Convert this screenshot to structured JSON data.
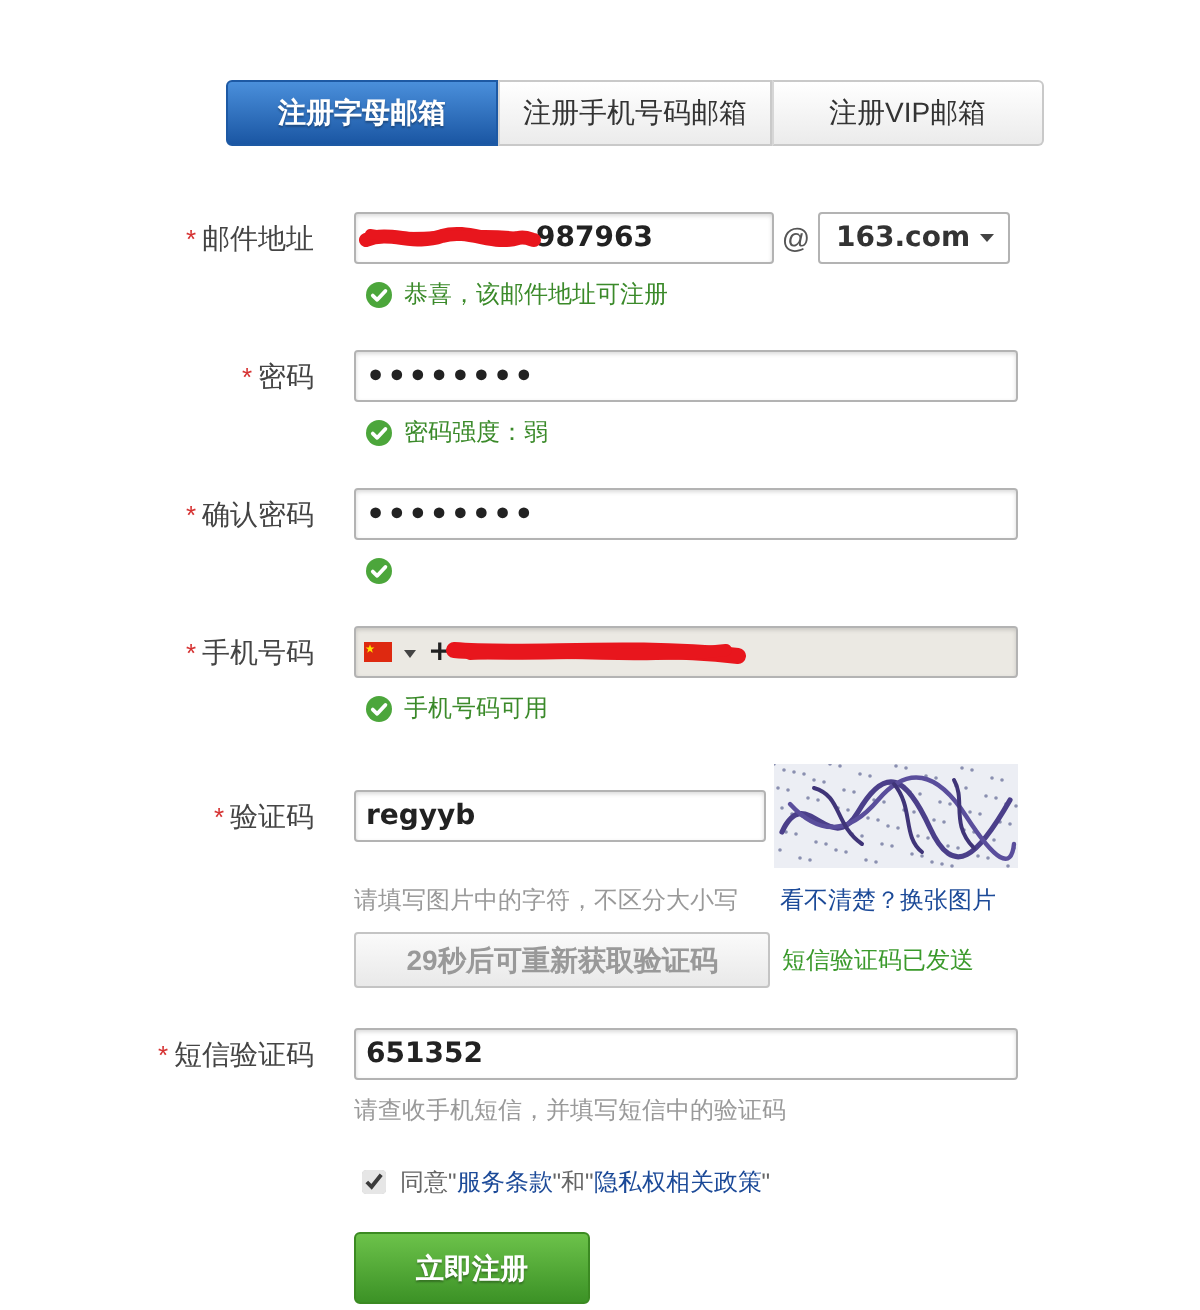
{
  "tabs": [
    {
      "label": "注册字母邮箱",
      "selected": true
    },
    {
      "label": "注册手机号码邮箱",
      "selected": false
    },
    {
      "label": "注册VIP邮箱",
      "selected": false
    }
  ],
  "fields": [
    {
      "kind": "email",
      "required_mark": "*",
      "label": "邮件地址",
      "value": "987963",
      "redacted": true,
      "at_sign": "@",
      "domain": "163.com",
      "message": {
        "kind": "success",
        "text": "恭喜，该邮件地址可注册"
      }
    },
    {
      "kind": "password",
      "required_mark": "*",
      "label": "密码",
      "value": "••••••••",
      "message": {
        "kind": "success",
        "text": "密码强度：弱"
      }
    },
    {
      "kind": "password",
      "required_mark": "*",
      "label": "确认密码",
      "value": "••••••••",
      "message": {
        "kind": "success"
      }
    },
    {
      "kind": "phone",
      "required_mark": "*",
      "label": "手机号码",
      "value": "+",
      "redacted": true,
      "disabled": true,
      "message": {
        "kind": "success",
        "text": "手机号码可用"
      }
    },
    {
      "kind": "captcha",
      "required_mark": "*",
      "label": "验证码",
      "value": "regyyb",
      "message": {
        "kind": "hint",
        "text": "请填写图片中的字符，不区分大小写"
      },
      "refresh_link": "看不清楚？换张图片",
      "sms_button": {
        "label": "29秒后可重新获取验证码",
        "disabled": true
      },
      "sms_status": "短信验证码已发送"
    },
    {
      "kind": "sms",
      "required_mark": "*",
      "label": "短信验证码",
      "value": "651352",
      "message": {
        "kind": "hint",
        "text": "请查收手机短信，并填写短信中的验证码"
      }
    }
  ],
  "agreement": {
    "checked": true,
    "parts": [
      {
        "kind": "text",
        "text": "同意\""
      },
      {
        "kind": "link",
        "text": "服务条款"
      },
      {
        "kind": "text",
        "text": "\"和\""
      },
      {
        "kind": "link",
        "text": "隐私权相关政策"
      },
      {
        "kind": "text",
        "text": "\""
      }
    ]
  },
  "submit": {
    "label": "立即注册"
  }
}
